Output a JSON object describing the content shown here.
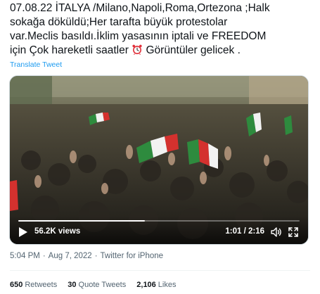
{
  "tweet": {
    "text": "07.08.22 İTALYA /Milano,Napoli,Roma,Ortezona ;Halk\nsokağa döküldü;Her tarafta büyük protestolar\nvar.Meclis basıldı.İklim yasasının iptali ve FREEDOM\niçin Çok hareketli saatler",
    "text_after_emoji": " Görüntüler gelicek .",
    "emoji": "alarm-clock-icon",
    "translate_label": "Translate Tweet"
  },
  "video": {
    "views": "56.2K views",
    "time": "1:01 / 2:16",
    "progress": 0.45,
    "play_icon": "play-icon",
    "volume_icon": "volume-icon",
    "fullscreen_icon": "fullscreen-icon"
  },
  "meta": {
    "time": "5:04 PM",
    "date": "Aug 7, 2022",
    "source": "Twitter for iPhone",
    "separator": "·"
  },
  "stats": {
    "retweets": {
      "count": "650",
      "label": "Retweets"
    },
    "quote_tweets": {
      "count": "30",
      "label": "Quote Tweets"
    },
    "likes": {
      "count": "2,106",
      "label": "Likes"
    }
  },
  "colors": {
    "link": "#1d9bf0",
    "text": "#0f1419",
    "muted": "#536471",
    "flag_green": "#2e8b3e",
    "flag_red": "#d4312e"
  }
}
